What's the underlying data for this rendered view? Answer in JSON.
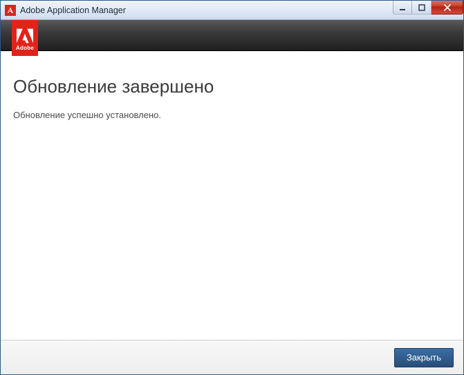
{
  "window": {
    "title": "Adobe Application Manager"
  },
  "brand": {
    "name": "Adobe"
  },
  "content": {
    "headline": "Обновление завершено",
    "message": "Обновление успешно установлено."
  },
  "footer": {
    "close_label": "Закрыть"
  }
}
